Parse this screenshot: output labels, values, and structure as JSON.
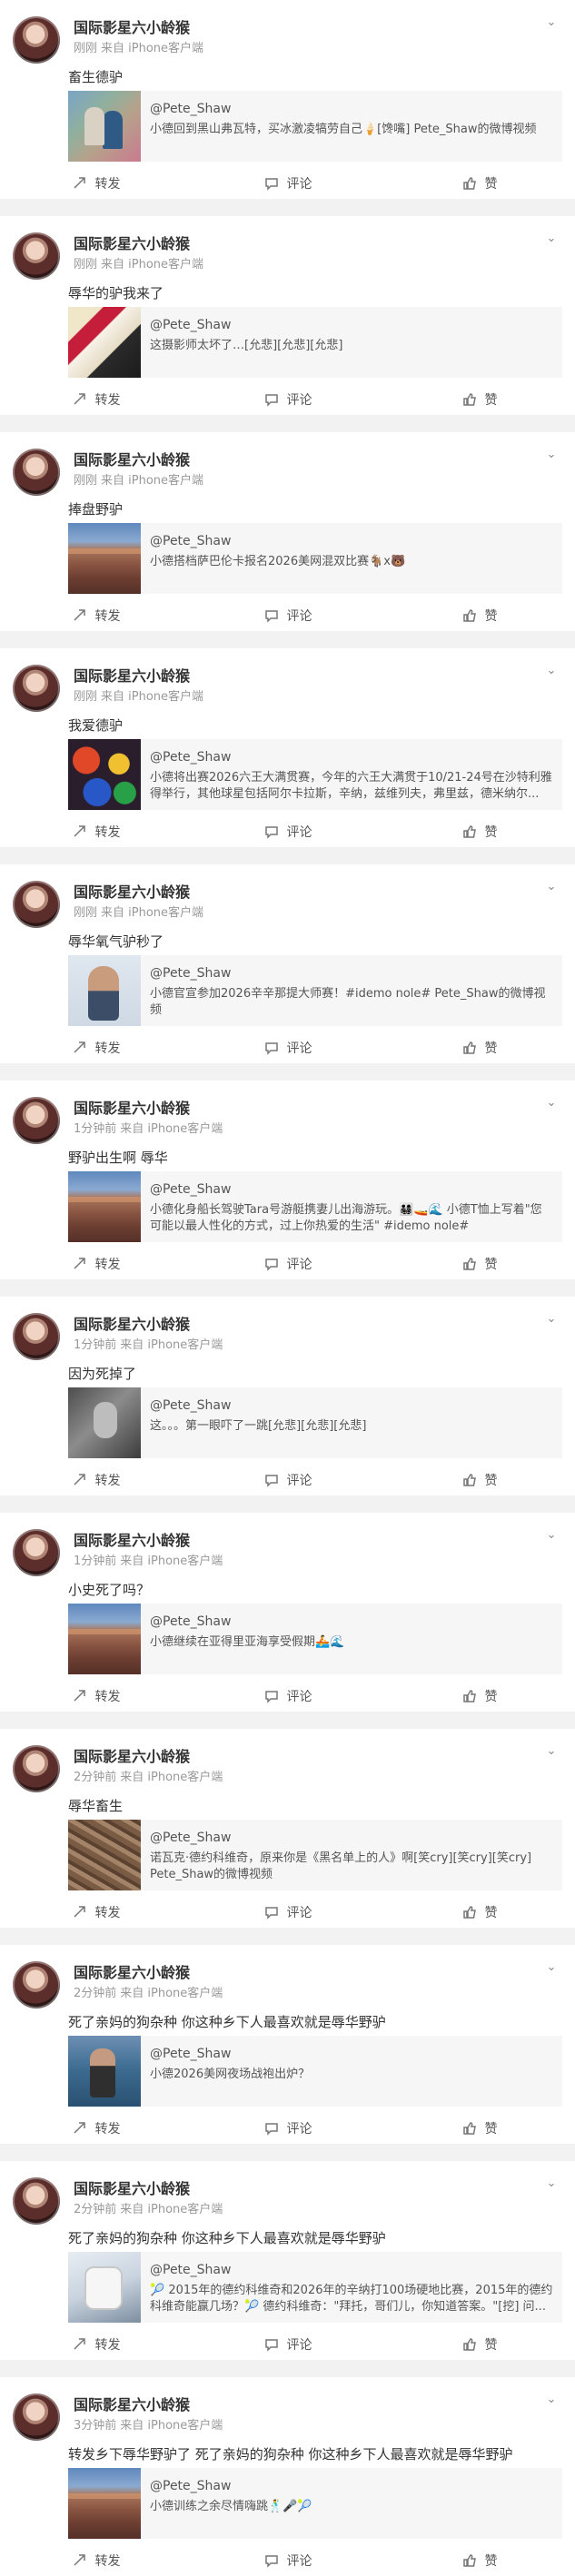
{
  "actions": {
    "repost": "转发",
    "comment": "评论",
    "like": "赞"
  },
  "posts": [
    {
      "user": "国际影星六小龄猴",
      "time": "刚刚",
      "source": "来自 iPhone客户端",
      "text": "畜生德驴",
      "share_user": "@Pete_Shaw",
      "share_desc": "小德回到黑山弗瓦特，买冰激凌犒劳自己🍦[馋嘴] Pete_Shaw的微博视频"
    },
    {
      "user": "国际影星六小龄猴",
      "time": "刚刚",
      "source": "来自 iPhone客户端",
      "text": "辱华的驴我来了",
      "share_user": "@Pete_Shaw",
      "share_desc": "这摄影师太坏了…[允悲][允悲][允悲]"
    },
    {
      "user": "国际影星六小龄猴",
      "time": "刚刚",
      "source": "来自 iPhone客户端",
      "text": "捧盘野驴",
      "share_user": "@Pete_Shaw",
      "share_desc": "小德搭档萨巴伦卡报名2026美网混双比赛🐐x🐻"
    },
    {
      "user": "国际影星六小龄猴",
      "time": "刚刚",
      "source": "来自 iPhone客户端",
      "text": "我爱德驴",
      "share_user": "@Pete_Shaw",
      "share_desc": "小德将出赛2026六王大满贯赛，今年的六王大满贯于10/21-24号在沙特利雅得举行，其他球星包括阿尔卡拉斯，辛纳，兹维列夫，弗里兹，德米纳尔..."
    },
    {
      "user": "国际影星六小龄猴",
      "time": "刚刚",
      "source": "来自 iPhone客户端",
      "text": "辱华氧气驴秒了",
      "share_user": "@Pete_Shaw",
      "share_desc": "小德官宣参加2026辛辛那提大师赛！#idemo nole# Pete_Shaw的微博视频"
    },
    {
      "user": "国际影星六小龄猴",
      "time": "1分钟前",
      "source": "来自 iPhone客户端",
      "text": "野驴出生啊 辱华",
      "share_user": "@Pete_Shaw",
      "share_desc": "小德化身船长驾驶Tara号游艇携妻儿出海游玩。👨‍👩‍👧‍👦🚤🌊 小德T恤上写着\"您可能以最人性化的方式，过上你热爱的生活\" #idemo nole#"
    },
    {
      "user": "国际影星六小龄猴",
      "time": "1分钟前",
      "source": "来自 iPhone客户端",
      "text": "因为死掉了",
      "share_user": "@Pete_Shaw",
      "share_desc": "这。。。第一眼吓了一跳[允悲][允悲][允悲]"
    },
    {
      "user": "国际影星六小龄猴",
      "time": "1分钟前",
      "source": "来自 iPhone客户端",
      "text": "小史死了吗？",
      "share_user": "@Pete_Shaw",
      "share_desc": "小德继续在亚得里亚海享受假期🚣🌊"
    },
    {
      "user": "国际影星六小龄猴",
      "time": "2分钟前",
      "source": "来自 iPhone客户端",
      "text": "辱华畜生",
      "share_user": "@Pete_Shaw",
      "share_desc": "诺瓦克·德约科维奇，原来你是《黑名单上的人》啊[笑cry][笑cry][笑cry] Pete_Shaw的微博视频"
    },
    {
      "user": "国际影星六小龄猴",
      "time": "2分钟前",
      "source": "来自 iPhone客户端",
      "text": "死了亲妈的狗杂种 你这种乡下人最喜欢就是辱华野驴",
      "share_user": "@Pete_Shaw",
      "share_desc": "小德2026美网夜场战袍出炉？"
    },
    {
      "user": "国际影星六小龄猴",
      "time": "2分钟前",
      "source": "来自 iPhone客户端",
      "text": "死了亲妈的狗杂种 你这种乡下人最喜欢就是辱华野驴",
      "share_user": "@Pete_Shaw",
      "share_desc": "🎾 2015年的德约科维奇和2026年的辛纳打100场硬地比赛，2015年的德约科维奇能赢几场？🎾 德约科维奇：\"拜托，哥们儿，你知道答案。\"[挖] 问..."
    },
    {
      "user": "国际影星六小龄猴",
      "time": "3分钟前",
      "source": "来自 iPhone客户端",
      "text": "转发乡下辱华野驴了 死了亲妈的狗杂种 你这种乡下人最喜欢就是辱华野驴",
      "share_user": "@Pete_Shaw",
      "share_desc": "小德训练之余尽情嗨跳🕺🎤🎾"
    }
  ]
}
